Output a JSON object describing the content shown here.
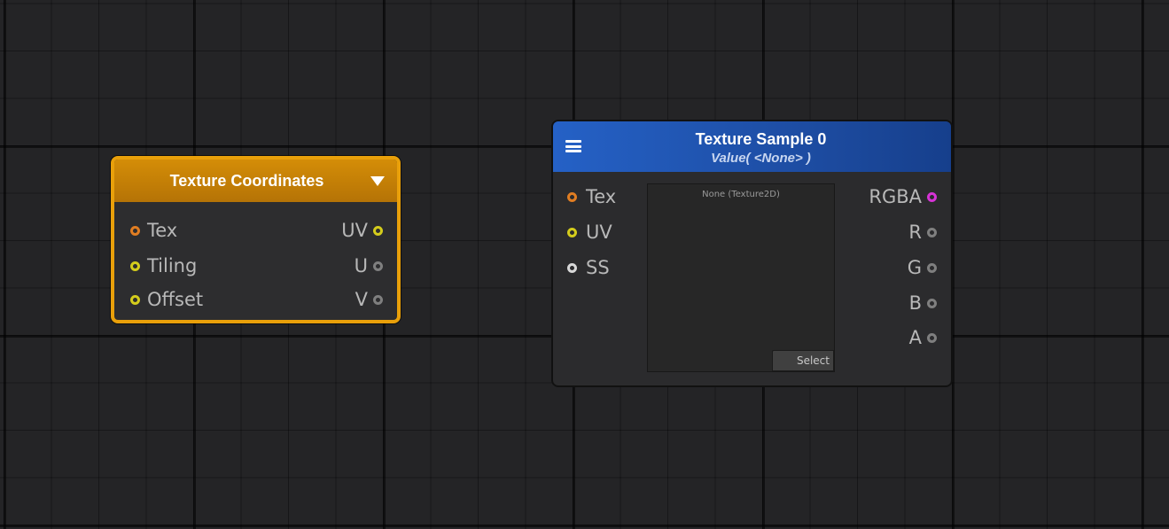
{
  "colors": {
    "tex_coords_header": "#d48d07",
    "tex_coords_border": "#e9a00a",
    "tex_sample_header": "#2561c6",
    "port_orange": "#e07d22",
    "port_yellow": "#d4cc1c",
    "port_white": "#d8d8d8",
    "port_magenta": "#d633d6",
    "port_grey": "#7f7f7f"
  },
  "texture_coordinates": {
    "title": "Texture Coordinates",
    "dropdown_icon": "triangle-down-icon",
    "inputs": [
      {
        "label": "Tex"
      },
      {
        "label": "Tiling"
      },
      {
        "label": "Offset"
      }
    ],
    "outputs": [
      {
        "label": "UV"
      },
      {
        "label": "U"
      },
      {
        "label": "V"
      }
    ]
  },
  "texture_sample": {
    "title": "Texture Sample 0",
    "subtitle": "Value( <None> )",
    "menu_icon": "hamburger-menu-icon",
    "inputs": [
      {
        "label": "Tex"
      },
      {
        "label": "UV"
      },
      {
        "label": "SS"
      }
    ],
    "outputs": [
      {
        "label": "RGBA"
      },
      {
        "label": "R"
      },
      {
        "label": "G"
      },
      {
        "label": "B"
      },
      {
        "label": "A"
      }
    ],
    "preview": {
      "texture_name": "None (Texture2D)",
      "select_label": "Select"
    }
  }
}
